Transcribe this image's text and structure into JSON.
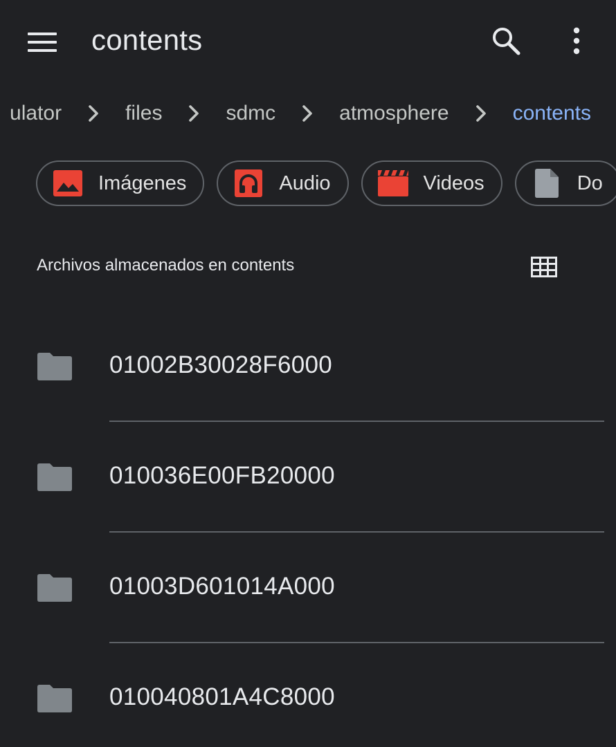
{
  "appbar": {
    "title": "contents",
    "menu_icon": "hamburger-menu-icon",
    "search_icon": "search-icon",
    "more_icon": "more-vert-icon"
  },
  "breadcrumb": {
    "items": [
      "ulator",
      "files",
      "sdmc",
      "atmosphere",
      "contents"
    ],
    "separator_icon": "chevron-right-icon"
  },
  "chips": [
    {
      "label": "Imágenes",
      "icon": "image-icon",
      "color": "#ea4335"
    },
    {
      "label": "Audio",
      "icon": "headphones-icon",
      "color": "#ea4335"
    },
    {
      "label": "Videos",
      "icon": "clapperboard-icon",
      "color": "#ea4335"
    },
    {
      "label": "Do",
      "icon": "document-icon",
      "color": "#9aa0a6"
    }
  ],
  "section": {
    "title": "Archivos almacenados en contents",
    "view_toggle_icon": "grid-view-icon"
  },
  "files": [
    {
      "name": "01002B30028F6000",
      "icon": "folder-icon"
    },
    {
      "name": "010036E00FB20000",
      "icon": "folder-icon"
    },
    {
      "name": "01003D601014A000",
      "icon": "folder-icon"
    },
    {
      "name": "010040801A4C8000",
      "icon": "folder-icon"
    }
  ],
  "colors": {
    "background": "#202124",
    "text": "#e8eaed",
    "accent": "#8ab4f8",
    "chip_border": "#5f6368",
    "folder": "#80868b",
    "chip_icon_red": "#ea4335"
  }
}
